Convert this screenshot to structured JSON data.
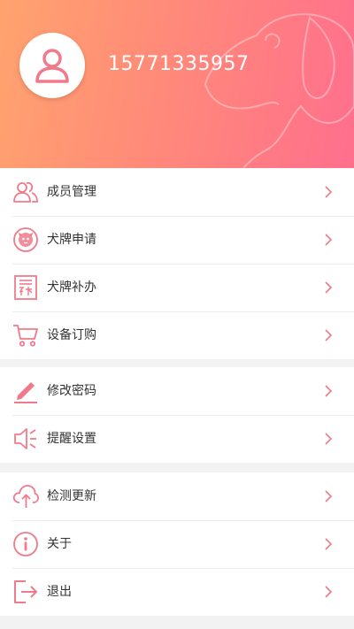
{
  "header": {
    "phone": "15771335957"
  },
  "menu_groups": [
    {
      "items": [
        {
          "label": "成员管理",
          "icon": "members-icon"
        },
        {
          "label": "犬牌申请",
          "icon": "dog-tag-apply-icon"
        },
        {
          "label": "犬牌补办",
          "icon": "dog-tag-reissue-icon"
        },
        {
          "label": "设备订购",
          "icon": "shopping-cart-icon"
        }
      ]
    },
    {
      "items": [
        {
          "label": "修改密码",
          "icon": "edit-pen-icon"
        },
        {
          "label": "提醒设置",
          "icon": "speaker-icon"
        }
      ]
    },
    {
      "items": [
        {
          "label": "检测更新",
          "icon": "cloud-upload-icon"
        },
        {
          "label": "关于",
          "icon": "info-icon"
        },
        {
          "label": "退出",
          "icon": "logout-icon"
        }
      ]
    }
  ],
  "colors": {
    "accent": "#f07a8a",
    "header_gradient_start": "#ffa36e",
    "header_gradient_end": "#ff6f8d"
  }
}
